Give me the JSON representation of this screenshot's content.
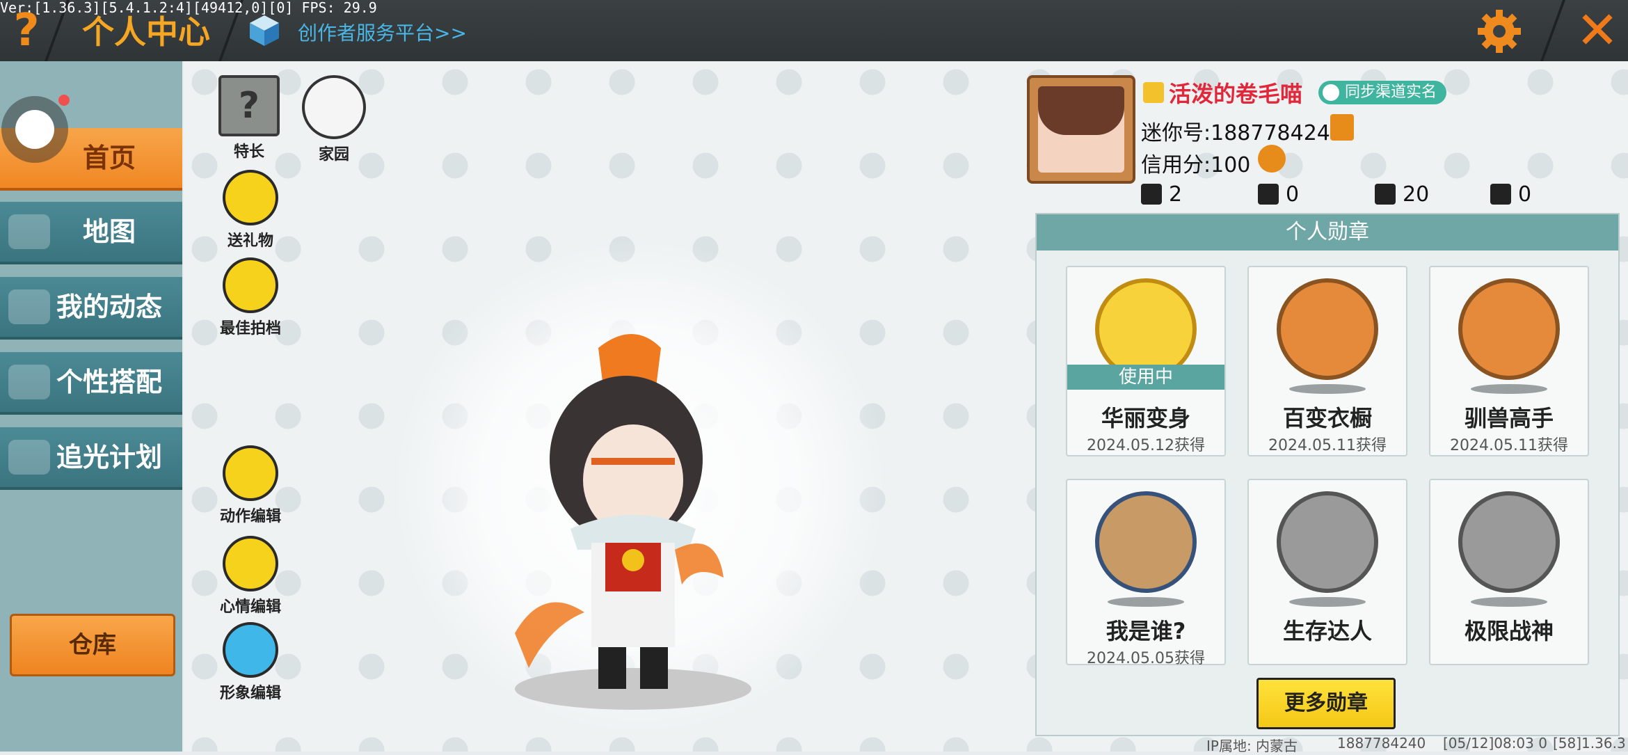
{
  "debug": "Ver:[1.36.3][5.4.1.2:4][49412,0][0] FPS: 29.9",
  "header": {
    "help_glyph": "?",
    "title": "个人中心",
    "creator_link": "创作者服务平台>>",
    "close_glyph": "✕"
  },
  "sidebar": {
    "items": [
      {
        "label": "首页",
        "active": true
      },
      {
        "label": "地图",
        "active": false
      },
      {
        "label": "我的动态",
        "active": false
      },
      {
        "label": "个性搭配",
        "active": false
      },
      {
        "label": "追光计划",
        "active": false
      }
    ],
    "storage_label": "仓库"
  },
  "actions": {
    "talent": "特长",
    "talent_glyph": "?",
    "home": "家园",
    "gift": "送礼物",
    "partner": "最佳拍档",
    "action_edit": "动作编辑",
    "mood_edit": "心情编辑",
    "look_edit": "形象编辑"
  },
  "profile": {
    "nickname": "活泼的卷毛喵",
    "realname_badge": "同步渠道实名",
    "mini_id": "迷你号:1887784240",
    "credit": "信用分:100",
    "stats": {
      "follows": "2",
      "fans": "0",
      "popularity": "20",
      "likes": "0"
    }
  },
  "medals": {
    "title": "个人勋章",
    "in_use_label": "使用中",
    "items": [
      {
        "name": "华丽变身",
        "date": "2024.05.12获得"
      },
      {
        "name": "百变衣橱",
        "date": "2024.05.11获得"
      },
      {
        "name": "驯兽高手",
        "date": "2024.05.11获得"
      },
      {
        "name": "我是谁?",
        "date": "2024.05.05获得"
      },
      {
        "name": "生存达人",
        "date": ""
      },
      {
        "name": "极限战神",
        "date": ""
      }
    ],
    "more_label": "更多勋章"
  },
  "footer": {
    "ip": "IP属地: 内蒙古",
    "uid": "1887784240",
    "timestamp": "[05/12]08:03 0",
    "version": "[58]1.36.3"
  },
  "colors": {
    "accent_orange": "#f08723",
    "teal": "#4b8a95",
    "nickname_red": "#e0283a"
  }
}
